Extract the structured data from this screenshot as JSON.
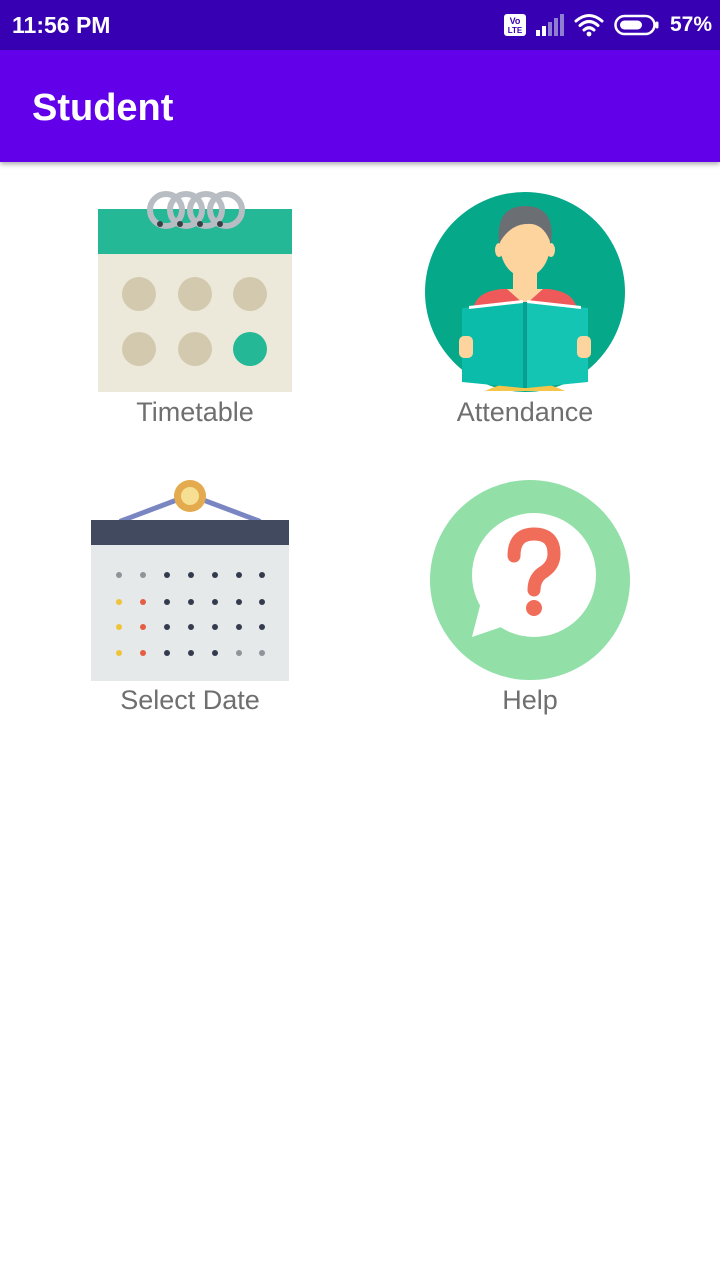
{
  "status_bar": {
    "time": "11:56 PM",
    "battery_percent": "57%",
    "volte_label_top": "Vo",
    "volte_label_bottom": "LTE",
    "icons": [
      "volte-icon",
      "signal-icon",
      "wifi-icon",
      "battery-icon"
    ]
  },
  "app_bar": {
    "title": "Student"
  },
  "tiles": [
    {
      "label": "Timetable",
      "icon": "calendar-icon"
    },
    {
      "label": "Attendance",
      "icon": "student-reading-icon"
    },
    {
      "label": "Select Date",
      "icon": "date-calendar-icon"
    },
    {
      "label": "Help",
      "icon": "help-bubble-icon"
    }
  ],
  "colors": {
    "status_bar": "#3700b3",
    "app_bar": "#6200ea",
    "label_text": "#6f6f6f"
  }
}
